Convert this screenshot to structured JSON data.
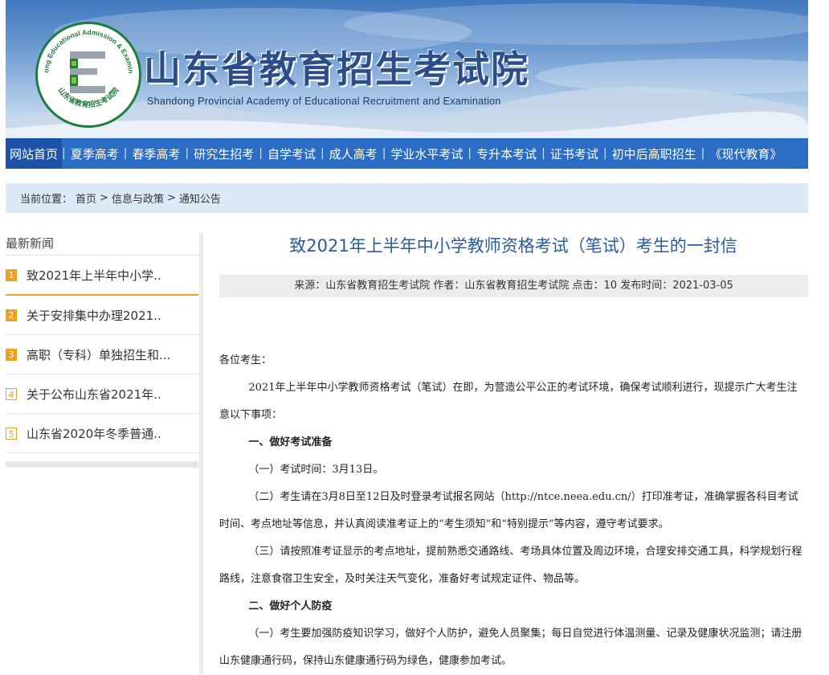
{
  "site": {
    "title_cn": "山东省教育招生考试院",
    "title_en": "Shandong Provincial Academy of Educational Recruitment and Examination",
    "logo_ring_text": "Shandong Educational Admission & Examinations",
    "logo_bottom_text": "山东省教育招生考试院"
  },
  "nav": {
    "items": [
      {
        "label": "网站首页"
      },
      {
        "label": "夏季高考"
      },
      {
        "label": "春季高考"
      },
      {
        "label": "研究生招考"
      },
      {
        "label": "自学考试"
      },
      {
        "label": "成人高考"
      },
      {
        "label": "学业水平考试"
      },
      {
        "label": "专升本考试"
      },
      {
        "label": "证书考试"
      },
      {
        "label": "初中后高职招生"
      },
      {
        "label": "《现代教育》"
      }
    ],
    "separator": "|"
  },
  "breadcrumb": {
    "lead": "当前位置：",
    "items": [
      "首页",
      "信息与政策",
      "通知公告"
    ],
    "sep": ">"
  },
  "sidebar": {
    "heading": "最新新闻",
    "items": [
      {
        "num": "1",
        "text": "致2021年上半年中小学.."
      },
      {
        "num": "2",
        "text": "关于安排集中办理2021.."
      },
      {
        "num": "3",
        "text": "高职（专科）单独招生和..."
      },
      {
        "num": "4",
        "text": "关于公布山东省2021年.."
      },
      {
        "num": "5",
        "text": "山东省2020年冬季普通.."
      }
    ]
  },
  "article": {
    "title": "致2021年上半年中小学教师资格考试（笔试）考生的一封信",
    "meta": "来源：山东省教育招生考试院 作者：山东省教育招生考试院 点击：10 发布时间：2021-03-05",
    "greeting": "各位考生：",
    "intro": "2021年上半年中小学教师资格考试（笔试）在即，为营造公平公正的考试环境，确保考试顺利进行，现提示广大考生注意以下事项：",
    "h1": "一、做好考试准备",
    "p1": "（一）考试时间：3月13日。",
    "p2": "（二）考生请在3月8日至12日及时登录考试报名网站（http://ntce.neea.edu.cn/）打印准考证，准确掌握各科目考试时间、考点地址等信息，并认真阅读准考证上的“考生须知”和“特别提示”等内容，遵守考试要求。",
    "p3": "（三）请按照准考证显示的考点地址，提前熟悉交通路线、考场具体位置及周边环境，合理安排交通工具，科学规划行程路线，注意食宿卫生安全，及时关注天气变化，准备好考试规定证件、物品等。",
    "h2": "二、做好个人防疫",
    "p4": "（一）考生要加强防疫知识学习，做好个人防护，避免人员聚集；每日自觉进行体温测量、记录及健康状况监测；请注册山东健康通行码，保持山东健康通行码为绿色，健康参加考试。"
  },
  "colors": {
    "nav_bg": "#2b6cc4",
    "nav_active": "#1e54a8",
    "crumb_bg": "#dceaf7",
    "title_blue": "#2a5aa0",
    "badge_orange": "#f0a020"
  }
}
